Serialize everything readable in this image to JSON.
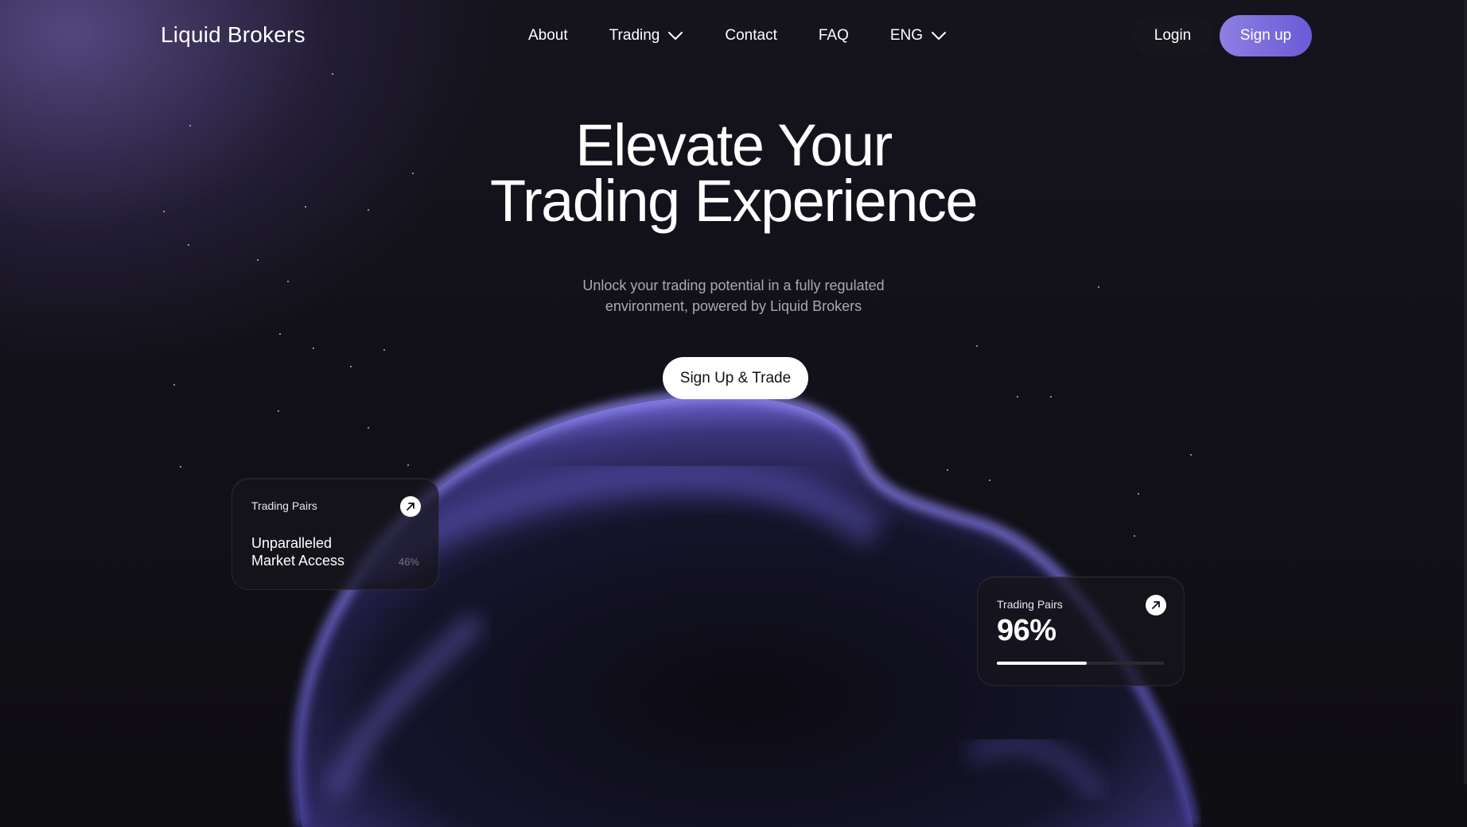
{
  "brand": {
    "logo": "Liquid Brokers"
  },
  "nav": {
    "items": [
      {
        "label": "About",
        "has_dropdown": false
      },
      {
        "label": "Trading",
        "has_dropdown": true
      },
      {
        "label": "Contact",
        "has_dropdown": false
      },
      {
        "label": "FAQ",
        "has_dropdown": false
      },
      {
        "label": "ENG",
        "has_dropdown": true
      }
    ],
    "login_label": "Login",
    "signup_label": "Sign up"
  },
  "hero": {
    "title_line1": "Elevate Your",
    "title_line2": "Trading Experience",
    "subtitle_line1": "Unlock your trading potential in a fully regulated",
    "subtitle_line2": "environment, powered by Liquid Brokers",
    "cta_label": "Sign Up & Trade"
  },
  "cards": {
    "left": {
      "label": "Trading Pairs",
      "heading_line1": "Unparalleled",
      "heading_line2": "Market Access",
      "percent": "46%",
      "icon": "arrow-up-right-icon"
    },
    "right": {
      "label": "Trading Pairs",
      "value": "96%",
      "progress": 0.54,
      "icon": "arrow-up-right-icon"
    }
  },
  "colors": {
    "background": "#0f0e13",
    "accent_purple": "#7b6be0",
    "blob": "#6b63c8"
  }
}
